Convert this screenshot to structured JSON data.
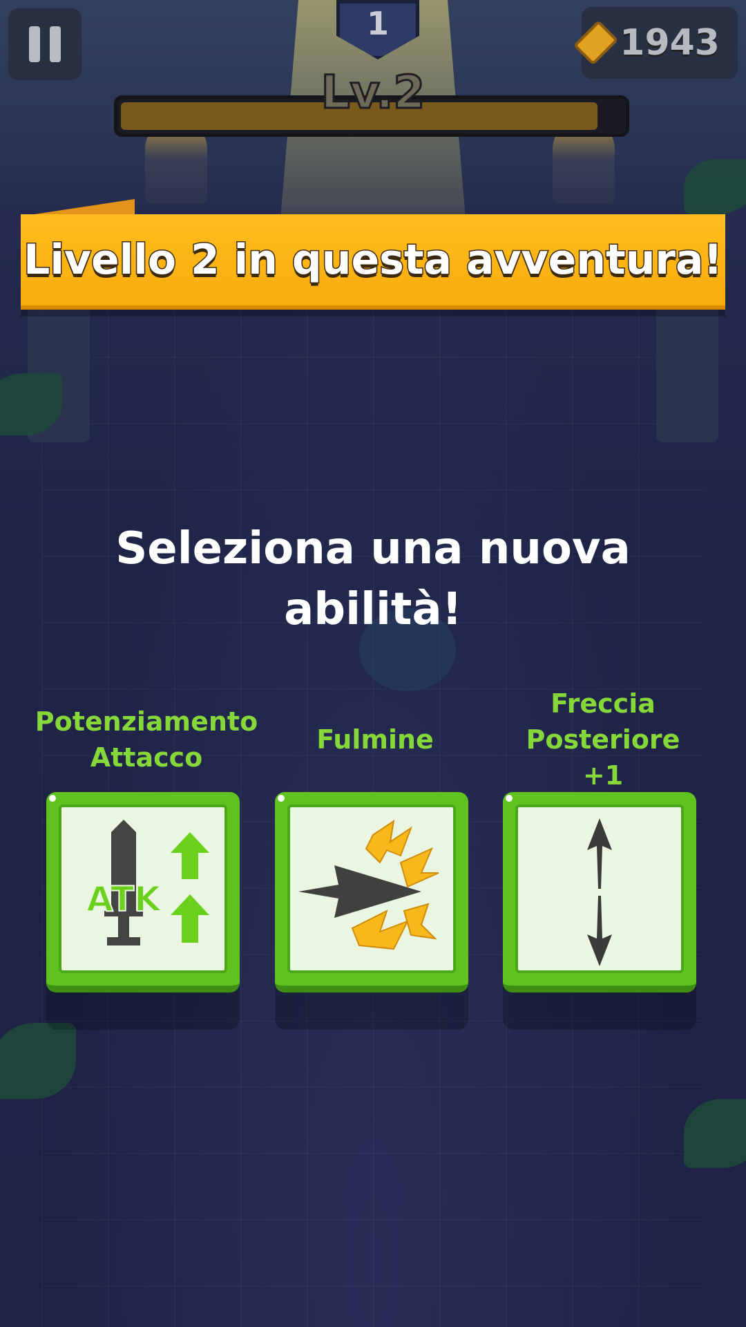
{
  "hud": {
    "stage_number": "1",
    "level_label": "Lv.2",
    "xp_progress": 0.95,
    "gold": "1943"
  },
  "banner": {
    "text": "Livello 2 in questa avventura!"
  },
  "prompt": {
    "line1": "Seleziona una nuova",
    "line2": "abilità!"
  },
  "abilities": [
    {
      "name_line1": "Potenziamento",
      "name_line2": "Attacco",
      "icon": "attack-boost-icon",
      "icon_text": "ATK"
    },
    {
      "name_line1": "",
      "name_line2": "Fulmine",
      "icon": "lightning-arrow-icon"
    },
    {
      "name_line1": "Freccia",
      "name_line2": "Posteriore +1",
      "icon": "rear-arrow-icon"
    }
  ],
  "colors": {
    "banner": "#ffbd1d",
    "card_green": "#5fc21f",
    "ability_name": "#86d83a",
    "background": "#1d2143"
  }
}
